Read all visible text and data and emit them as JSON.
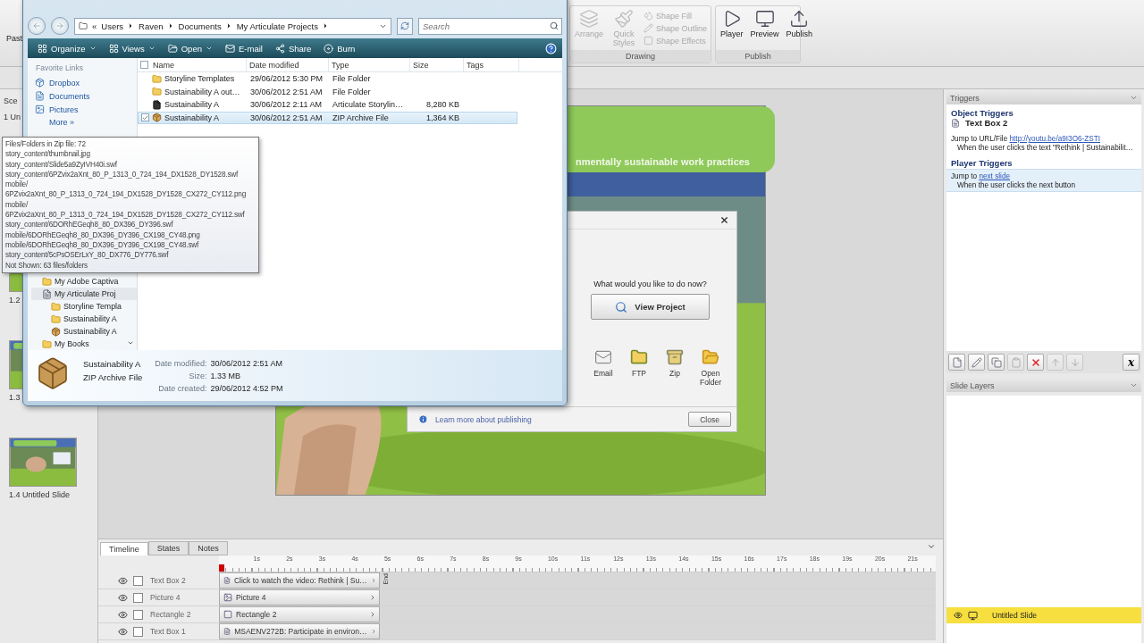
{
  "ribbon": {
    "cut_label": "Past",
    "groups": [
      {
        "title": "Drawing",
        "disabled": true,
        "large": [
          {
            "label": "Arrange"
          },
          {
            "label": "Quick Styles"
          }
        ],
        "small": [
          "Shape Fill",
          "Shape Outline",
          "Shape Effects"
        ]
      },
      {
        "title": "Publish",
        "disabled": false,
        "large": [
          {
            "label": "Player"
          },
          {
            "label": "Preview"
          },
          {
            "label": "Publish"
          }
        ]
      }
    ]
  },
  "scenes": {
    "header": "Sce",
    "scene": "1 Un",
    "slides": [
      {
        "label": "1.2"
      },
      {
        "label": "1.3"
      },
      {
        "label": "1.4 Untitled Slide"
      }
    ]
  },
  "slide": {
    "banner": "nmentally sustainable work practices"
  },
  "timeline": {
    "tabs": [
      {
        "label": "Timeline",
        "selected": true
      },
      {
        "label": "States",
        "selected": false
      },
      {
        "label": "Notes",
        "selected": false
      }
    ],
    "ticks": [
      "1s",
      "2s",
      "3s",
      "4s",
      "5s",
      "6s",
      "7s",
      "8s",
      "9s",
      "10s",
      "11s",
      "12s",
      "13s",
      "14s",
      "15s",
      "16s",
      "17s",
      "18s",
      "19s",
      "20s",
      "21s"
    ],
    "end_marker": "End",
    "rows": [
      {
        "name": "Text Box 2",
        "kind": "text",
        "bar": "Click to watch the video: Rethink | Su…",
        "visible": true,
        "locked": false
      },
      {
        "name": "Picture 4",
        "kind": "picture",
        "bar": "Picture 4",
        "visible": true,
        "locked": false
      },
      {
        "name": "Rectangle 2",
        "kind": "shape",
        "bar": "Rectangle 2",
        "visible": true,
        "locked": false
      },
      {
        "name": "Text Box 1",
        "kind": "text",
        "bar": "MSAENV272B:  Participate in environ…",
        "visible": true,
        "locked": false
      }
    ]
  },
  "triggers": {
    "title": "Triggers",
    "object_heading": "Object Triggers",
    "object": "Text Box 2",
    "object_items": [
      {
        "action": "Jump to URL/File",
        "target": "http://youtu.be/a9I3O6-ZSTI",
        "condition": "When the user clicks the text \"Rethink | Sustainabilit…",
        "selected": false
      }
    ],
    "player_heading": "Player Triggers",
    "player_items": [
      {
        "action": "Jump to",
        "target": "next slide",
        "condition": "When the user clicks the next button",
        "selected": true
      }
    ],
    "tools": [
      {
        "kind": "new",
        "disabled": false
      },
      {
        "kind": "edit",
        "disabled": false
      },
      {
        "kind": "copy",
        "disabled": false
      },
      {
        "kind": "paste",
        "disabled": true
      },
      {
        "kind": "delete",
        "disabled": false
      },
      {
        "kind": "up",
        "disabled": true
      },
      {
        "kind": "down",
        "disabled": true
      },
      {
        "kind": "variables",
        "label": "x",
        "disabled": false
      }
    ]
  },
  "layers": {
    "title": "Slide Layers",
    "items": [
      {
        "label": "Untitled Slide",
        "selected": true
      }
    ]
  },
  "explorer": {
    "breadcrumb_prefix": "«",
    "breadcrumb": [
      "Users",
      "Raven",
      "Documents",
      "My Articulate Projects"
    ],
    "search_placeholder": "Search",
    "toolbar": [
      {
        "label": "Organize",
        "menu": true
      },
      {
        "label": "Views",
        "menu": true
      },
      {
        "label": "Open",
        "menu": true
      },
      {
        "label": "E-mail",
        "menu": false
      },
      {
        "label": "Share",
        "menu": false
      },
      {
        "label": "Burn",
        "menu": false
      }
    ],
    "favorites_title": "Favorite Links",
    "favorites": [
      {
        "label": "Dropbox"
      },
      {
        "label": "Documents"
      },
      {
        "label": "Pictures"
      }
    ],
    "more": "More",
    "more_glyph": "»",
    "tree": [
      {
        "label": "My Adobe Captiva",
        "kind": "folder",
        "selected": false
      },
      {
        "label": "My Articulate Proj",
        "kind": "project",
        "selected": true,
        "children": [
          {
            "label": "Storyline Templa",
            "kind": "folder",
            "selected": false
          },
          {
            "label": "Sustainability A",
            "kind": "folder",
            "selected": false
          },
          {
            "label": "Sustainability A",
            "kind": "archive",
            "selected": false
          }
        ]
      },
      {
        "label": "My Books",
        "kind": "folder",
        "selected": false
      }
    ],
    "select_all": false,
    "columns": [
      "Name",
      "Date modified",
      "Type",
      "Size",
      "Tags"
    ],
    "files": [
      {
        "name": "Storyline Templates",
        "date": "29/06/2012 5:30 PM",
        "type": "File Folder",
        "kind": "folder",
        "selected": false,
        "checked": false
      },
      {
        "name": "Sustainability A out…",
        "date": "30/06/2012 2:51 AM",
        "type": "File Folder",
        "kind": "folder",
        "selected": false,
        "checked": false
      },
      {
        "name": "Sustainability A",
        "date": "30/06/2012 2:11 AM",
        "type": "Articulate Storylin…",
        "size": "8,280 KB",
        "kind": "story",
        "selected": false,
        "checked": false
      },
      {
        "name": "Sustainability A",
        "date": "30/06/2012 2:51 AM",
        "type": "ZIP Archive File",
        "size": "1,364 KB",
        "kind": "archive",
        "selected": true,
        "checked": true
      }
    ],
    "details": {
      "name": "Sustainability A",
      "type": "ZIP Archive File",
      "fields": [
        {
          "label": "Date modified:",
          "value": "30/06/2012 2:51 AM"
        },
        {
          "label": "Size:",
          "value": "1.33 MB"
        },
        {
          "label": "Date created:",
          "value": "29/06/2012 4:52 PM"
        }
      ]
    }
  },
  "tooltip": {
    "lines": [
      "Files/Folders in Zip file: 72",
      "story_content/thumbnail.jpg",
      "story_content/Slide5a9ZyIVH40i.swf",
      "story_content/6PZvix2aXnt_80_P_1313_0_724_194_DX1528_DY1528.swf",
      "mobile/",
      "6PZvix2aXnt_80_P_1313_0_724_194_DX1528_DY1528_CX272_CY112.png",
      "mobile/",
      "6PZvix2aXnt_80_P_1313_0_724_194_DX1528_DY1528_CX272_CY112.swf",
      "story_content/6DORhEGeqh8_80_DX396_DY396.swf",
      "mobile/6DORhEGeqh8_80_DX396_DY396_CX198_CY48.png",
      "mobile/6DORhEGeqh8_80_DX396_DY396_CX198_CY48.swf",
      "story_content/5cPsOSErLxY_80_DX776_DY776.swf",
      "Not Shown: 63 files/folders"
    ]
  },
  "publish_dialog": {
    "question": "What would you like to do now?",
    "primary": "View Project",
    "actions": [
      {
        "label": "Email"
      },
      {
        "label": "FTP"
      },
      {
        "label": "Zip"
      },
      {
        "label": "Open Folder"
      }
    ],
    "link": "Learn more about publishing",
    "close": "Close"
  }
}
